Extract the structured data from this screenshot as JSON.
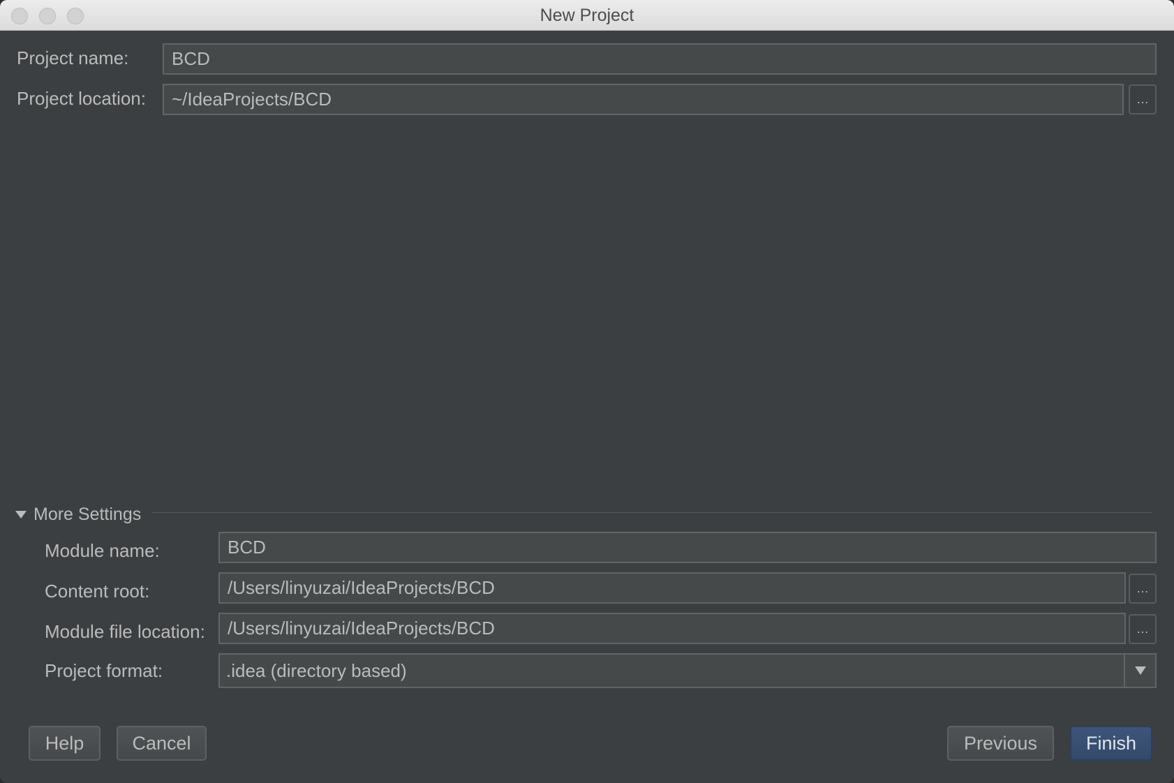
{
  "window": {
    "title": "New Project"
  },
  "project": {
    "name_label": "Project name:",
    "name_value": "BCD",
    "location_label": "Project location:",
    "location_value": "~/IdeaProjects/BCD",
    "browse_label": "…"
  },
  "more_settings": {
    "label": "More Settings",
    "expanded": true,
    "module_name_label": "Module name:",
    "module_name_value": "BCD",
    "content_root_label": "Content root:",
    "content_root_value": "/Users/linyuzai/IdeaProjects/BCD",
    "module_file_label": "Module file location:",
    "module_file_value": "/Users/linyuzai/IdeaProjects/BCD",
    "project_format_label": "Project format:",
    "project_format_value": ".idea (directory based)",
    "browse_label": "…"
  },
  "buttons": {
    "help": "Help",
    "cancel": "Cancel",
    "previous": "Previous",
    "finish": "Finish"
  },
  "colors": {
    "background": "#3c3f41",
    "field_background": "#45494a",
    "text": "#bbbbbb",
    "primary_button": "#365073"
  }
}
